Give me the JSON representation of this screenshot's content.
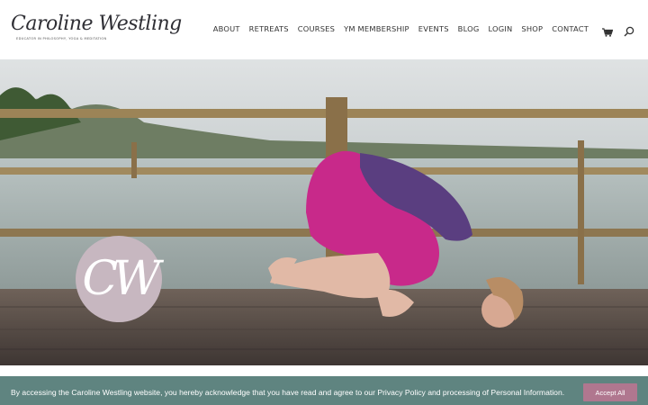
{
  "brand": {
    "logo_name": "Caroline Westling",
    "logo_tagline": "Educator in Philosophy, Yoga & Meditation"
  },
  "nav": {
    "items": [
      "ABOUT",
      "RETREATS",
      "COURSES",
      "YM MEMBERSHIP",
      "EVENTS",
      "BLOG",
      "LOGIN",
      "SHOP",
      "CONTACT"
    ],
    "cart_icon": "shopping-cart-icon",
    "search_icon": "search-icon"
  },
  "hero": {
    "badge_monogram": "CW",
    "badge_color": "#c7b7c0"
  },
  "cookie": {
    "message": "By accessing the Caroline Westling website, you hereby acknowledge that you have read and agree to our Privacy Policy and processing of Personal Information.",
    "accept_label": "Accept All",
    "bar_color": "#5f8480",
    "button_color": "#b0778f"
  }
}
